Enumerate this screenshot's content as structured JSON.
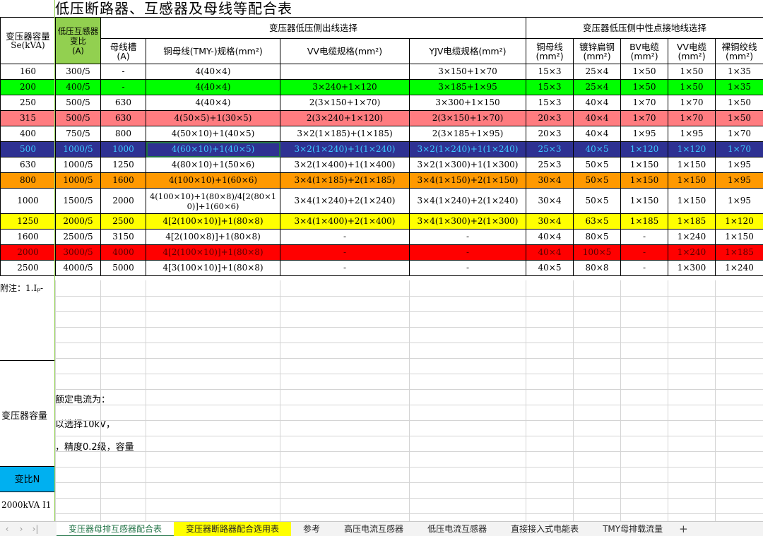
{
  "title": "低压断路器、互感器及母线等配合表",
  "headers": {
    "capacity": "变压器容量",
    "capacity_unit": "Se(kVA)",
    "ct_ratio": "低压互感器变比",
    "ct_unit": "(A)",
    "outgoing_group": "变压器低压侧出线选择",
    "neutral_group": "变压器低压侧中性点接地线选择",
    "busduct": "母线槽",
    "busduct_unit": "(A)",
    "cu_bus": "铜母线(TMY-)规格(mm²)",
    "vv_cable": "VV电缆规格(mm²)",
    "yjv_cable": "YJV电缆规格(mm²)",
    "n_cu_bus": "铜母线",
    "n_galv": "镀锌扁钢",
    "n_bv": "BV电缆",
    "n_vv": "VV电缆",
    "n_bare": "裸铜绞线",
    "mm2": "(mm²)"
  },
  "colors": {
    "green_header": "#92d050",
    "green": "#00ff00",
    "salmon": "#ff7c80",
    "navy": "#2e3192",
    "orange": "#ff9900",
    "yellow": "#ffff00",
    "red": "#ff0000",
    "white": "#ffffff"
  },
  "rows": [
    {
      "cap": "160",
      "ct": "300/5",
      "duct": "-",
      "cu": "4(40×4)",
      "vv": "",
      "yjv": "3×150+1×70",
      "ncu": "15×3",
      "galv": "25×4",
      "bv": "1×50",
      "nvv": "1×50",
      "bare": "1×35",
      "bg": "white",
      "fg": "#000000"
    },
    {
      "cap": "200",
      "ct": "400/5",
      "duct": "-",
      "cu": "4(40×4)",
      "vv": "3×240+1×120",
      "yjv": "3×185+1×95",
      "ncu": "15×3",
      "galv": "25×4",
      "bv": "1×50",
      "nvv": "1×50",
      "bare": "1×35",
      "bg": "green",
      "fg": "#000000"
    },
    {
      "cap": "250",
      "ct": "500/5",
      "duct": "630",
      "cu": "4(40×4)",
      "vv": "2(3×150+1×70)",
      "yjv": "3×300+1×150",
      "ncu": "15×3",
      "galv": "40×4",
      "bv": "1×70",
      "nvv": "1×70",
      "bare": "1×50",
      "bg": "white",
      "fg": "#000000"
    },
    {
      "cap": "315",
      "ct": "500/5",
      "duct": "630",
      "cu": "4(50×5)+1(30×5)",
      "vv": "2(3×240+1×120)",
      "yjv": "2(3×150+1×70)",
      "ncu": "20×3",
      "galv": "40×4",
      "bv": "1×70",
      "nvv": "1×70",
      "bare": "1×50",
      "bg": "salmon",
      "fg": "#000000"
    },
    {
      "cap": "400",
      "ct": "750/5",
      "duct": "800",
      "cu": "4(50×10)+1(40×5)",
      "vv": "3×2(1×185)+(1×185)",
      "yjv": "2(3×185+1×95)",
      "ncu": "20×3",
      "galv": "40×4",
      "bv": "1×95",
      "nvv": "1×95",
      "bare": "1×70",
      "bg": "white",
      "fg": "#000000"
    },
    {
      "cap": "500",
      "ct": "1000/5",
      "duct": "1000",
      "cu": "4(60×10)+1(40×5)",
      "vv": "3×2(1×240)+1(1×240)",
      "yjv": "3×2(1×240)+1(1×240)",
      "ncu": "25×3",
      "galv": "40×5",
      "bv": "1×120",
      "nvv": "1×120",
      "bare": "1×70",
      "bg": "navy",
      "fg": "#3fc8ff"
    },
    {
      "cap": "630",
      "ct": "1000/5",
      "duct": "1250",
      "cu": "4(80×10)+1(50×6)",
      "vv": "3×2(1×400)+1(1×400)",
      "yjv": "3×2(1×300)+1(1×300)",
      "ncu": "25×3",
      "galv": "50×5",
      "bv": "1×150",
      "nvv": "1×150",
      "bare": "1×95",
      "bg": "white",
      "fg": "#000000"
    },
    {
      "cap": "800",
      "ct": "1000/5",
      "duct": "1600",
      "cu": "4(100×10)+1(60×6)",
      "vv": "3×4(1×185)+2(1×185)",
      "yjv": "3×4(1×150)+2(1×150)",
      "ncu": "30×4",
      "galv": "50×5",
      "bv": "1×150",
      "nvv": "1×150",
      "bare": "1×95",
      "bg": "orange",
      "fg": "#000000"
    },
    {
      "cap": "1000",
      "ct": "1500/5",
      "duct": "2000",
      "cu": "4(100×10)+1(80×8)/4[2(80×10)]+1(60×6)",
      "vv": "3×4(1×240)+2(1×240)",
      "yjv": "3×4(1×240)+2(1×240)",
      "ncu": "30×4",
      "galv": "50×5",
      "bv": "1×150",
      "nvv": "1×150",
      "bare": "1×95",
      "bg": "white",
      "fg": "#000000",
      "tall": true
    },
    {
      "cap": "1250",
      "ct": "2000/5",
      "duct": "2500",
      "cu": "4[2(100×10)]+1(80×8)",
      "vv": "3×4(1×400)+2(1×400)",
      "yjv": "3×4(1×300)+2(1×300)",
      "ncu": "30×4",
      "galv": "63×5",
      "bv": "1×185",
      "nvv": "1×185",
      "bare": "1×120",
      "bg": "yellow",
      "fg": "#000000"
    },
    {
      "cap": "1600",
      "ct": "2500/5",
      "duct": "3150",
      "cu": "4[2(100×8)]+1(80×8)",
      "vv": "-",
      "yjv": "-",
      "ncu": "40×4",
      "galv": "80×5",
      "bv": "-",
      "nvv": "1×240",
      "bare": "1×150",
      "bg": "white",
      "fg": "#000000"
    },
    {
      "cap": "2000",
      "ct": "3000/5",
      "duct": "4000",
      "cu": "4[2(100×10)]+1(80×8)",
      "vv": "-",
      "yjv": "-",
      "ncu": "40×4",
      "galv": "100×5",
      "bv": "-",
      "nvv": "1×240",
      "bare": "1×185",
      "bg": "red",
      "fg": "#5a0000"
    },
    {
      "cap": "2500",
      "ct": "4000/5",
      "duct": "5000",
      "cu": "4[3(100×10)]+1(80×8)",
      "vv": "-",
      "yjv": "-",
      "ncu": "40×5",
      "galv": "80×8",
      "bv": "-",
      "nvv": "1×300",
      "bare": "1×240",
      "bg": "white",
      "fg": "#000000"
    }
  ],
  "note": "附注：1.Iₚ-",
  "lower": {
    "label": "变压器容量",
    "frag1": "额定电流为：",
    "frag2": "以选择10kV，",
    "frag3": "，精度0.2级，容量",
    "blue_label": "变比N",
    "bottom_text": "2000kVA I1"
  },
  "tabs": [
    {
      "label": "变压器母排互感器配合表",
      "state": "active"
    },
    {
      "label": "变压器断路器配合选用表",
      "state": "yellow"
    },
    {
      "label": "参考",
      "state": ""
    },
    {
      "label": "高压电流互感器",
      "state": ""
    },
    {
      "label": "低压电流互感器",
      "state": ""
    },
    {
      "label": "直接接入式电能表",
      "state": ""
    },
    {
      "label": "TMY母排载流量",
      "state": ""
    }
  ],
  "icons": {
    "prev": "chevron-left-icon",
    "next": "chevron-right-icon",
    "last": "chevron-last-icon",
    "add": "plus-icon"
  }
}
